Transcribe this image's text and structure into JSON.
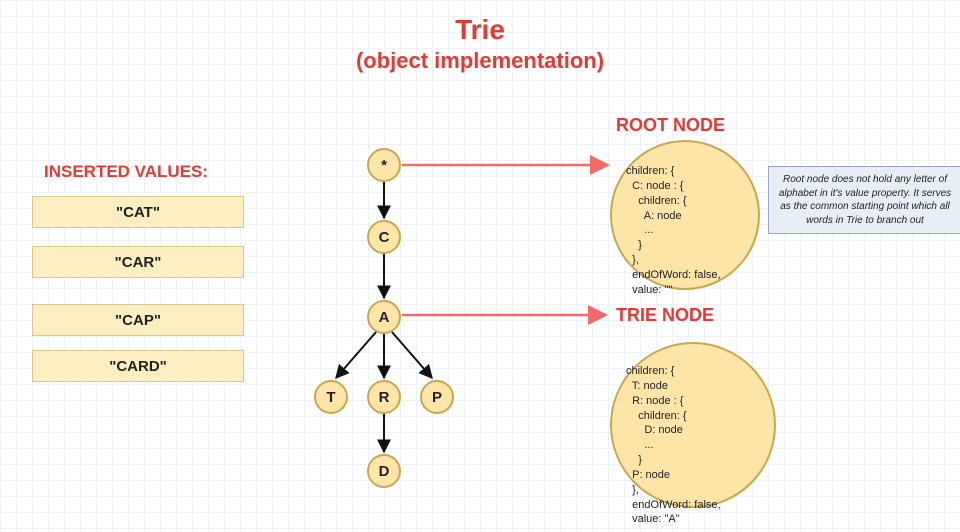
{
  "title": "Trie",
  "subtitle": "(object implementation)",
  "inserted_label": "INSERTED VALUES:",
  "inserted_values": [
    "\"CAT\"",
    "\"CAR\"",
    "\"CAP\"",
    "\"CARD\""
  ],
  "root_label": "ROOT NODE",
  "trienode_label": "TRIE NODE",
  "nodes": {
    "root": "*",
    "c": "C",
    "a": "A",
    "t": "T",
    "r": "R",
    "p": "P",
    "d": "D"
  },
  "root_obj_text": "children: {\n  C: node : {\n    children: {\n      A: node\n      ...\n    }\n  },\n  endOfWord: false,\n  value: \"\"",
  "trienode_obj_text": "children: {\n  T: node\n  R: node : {\n    children: {\n      D: node\n      ...\n    }\n  P: node\n  },\n  endOfWord: false,\n  value: \"A\"",
  "note_text": "Root node does not hold any letter of alphabet in it's value property.\nIt serves as the common starting point which all words in Trie to branch out",
  "colors": {
    "accent": "#e53935",
    "node_fill": "#ffe5a8",
    "node_border": "#c7a852",
    "box_fill": "#ffeec2",
    "note_fill": "#e8eef6",
    "note_border": "#95a9c5",
    "edge_red": "#f46a6a",
    "edge_black": "#111"
  }
}
